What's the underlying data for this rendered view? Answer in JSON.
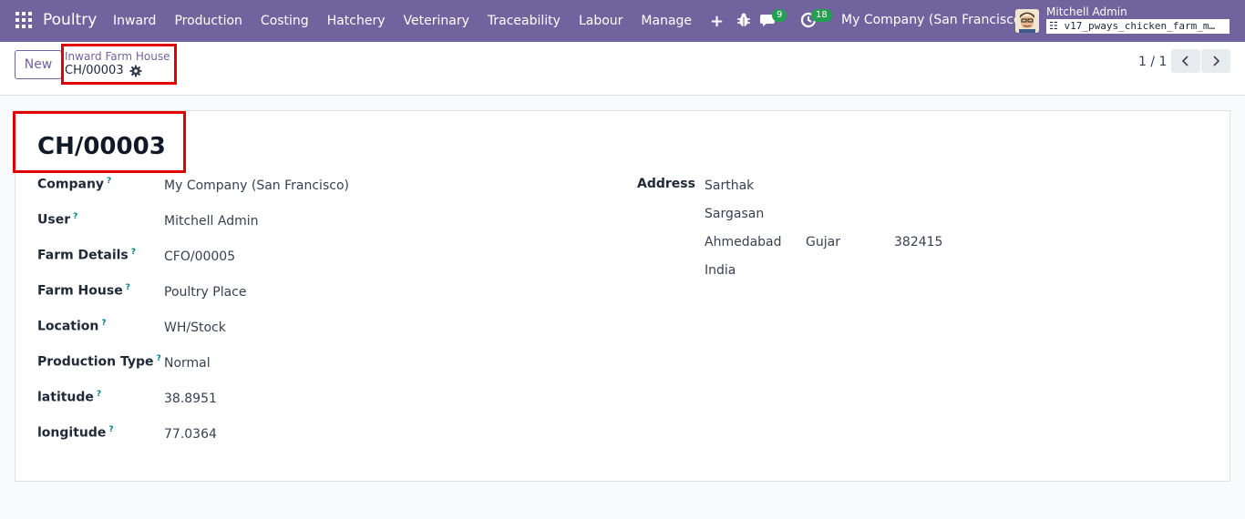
{
  "navbar": {
    "brand": "Poultry",
    "menu": [
      "Inward",
      "Production",
      "Costing",
      "Hatchery",
      "Veterinary",
      "Traceability",
      "Labour",
      "Manage"
    ],
    "plus": "+",
    "chat_count": "9",
    "activity_count": "18",
    "company": "My Company (San Francisco)",
    "user": "Mitchell Admin",
    "database": "v17_pways_chicken_farm_m…",
    "accent": "#71639e",
    "badge_color": "#21a151"
  },
  "control": {
    "new_label": "New",
    "breadcrumb_parent": "Inward Farm House",
    "breadcrumb_current": "CH/00003",
    "pager": "1 / 1"
  },
  "form": {
    "title": "CH/00003",
    "help_marker": "?",
    "fields": [
      {
        "label": "Company",
        "value": "My Company (San Francisco)"
      },
      {
        "label": "User",
        "value": "Mitchell Admin"
      },
      {
        "label": "Farm Details",
        "value": "CFO/00005"
      },
      {
        "label": "Farm House",
        "value": "Poultry Place"
      },
      {
        "label": "Location",
        "value": "WH/Stock"
      },
      {
        "label": "Production Type",
        "value": "Normal"
      },
      {
        "label": "latitude",
        "value": "38.8951"
      },
      {
        "label": "longitude",
        "value": "77.0364"
      }
    ],
    "address": {
      "label": "Address",
      "street": "Sarthak",
      "street2": "Sargasan",
      "city": "Ahmedabad",
      "state": "Gujarat",
      "zip": "382415",
      "country": "India"
    }
  },
  "highlight_color": "#e00000"
}
